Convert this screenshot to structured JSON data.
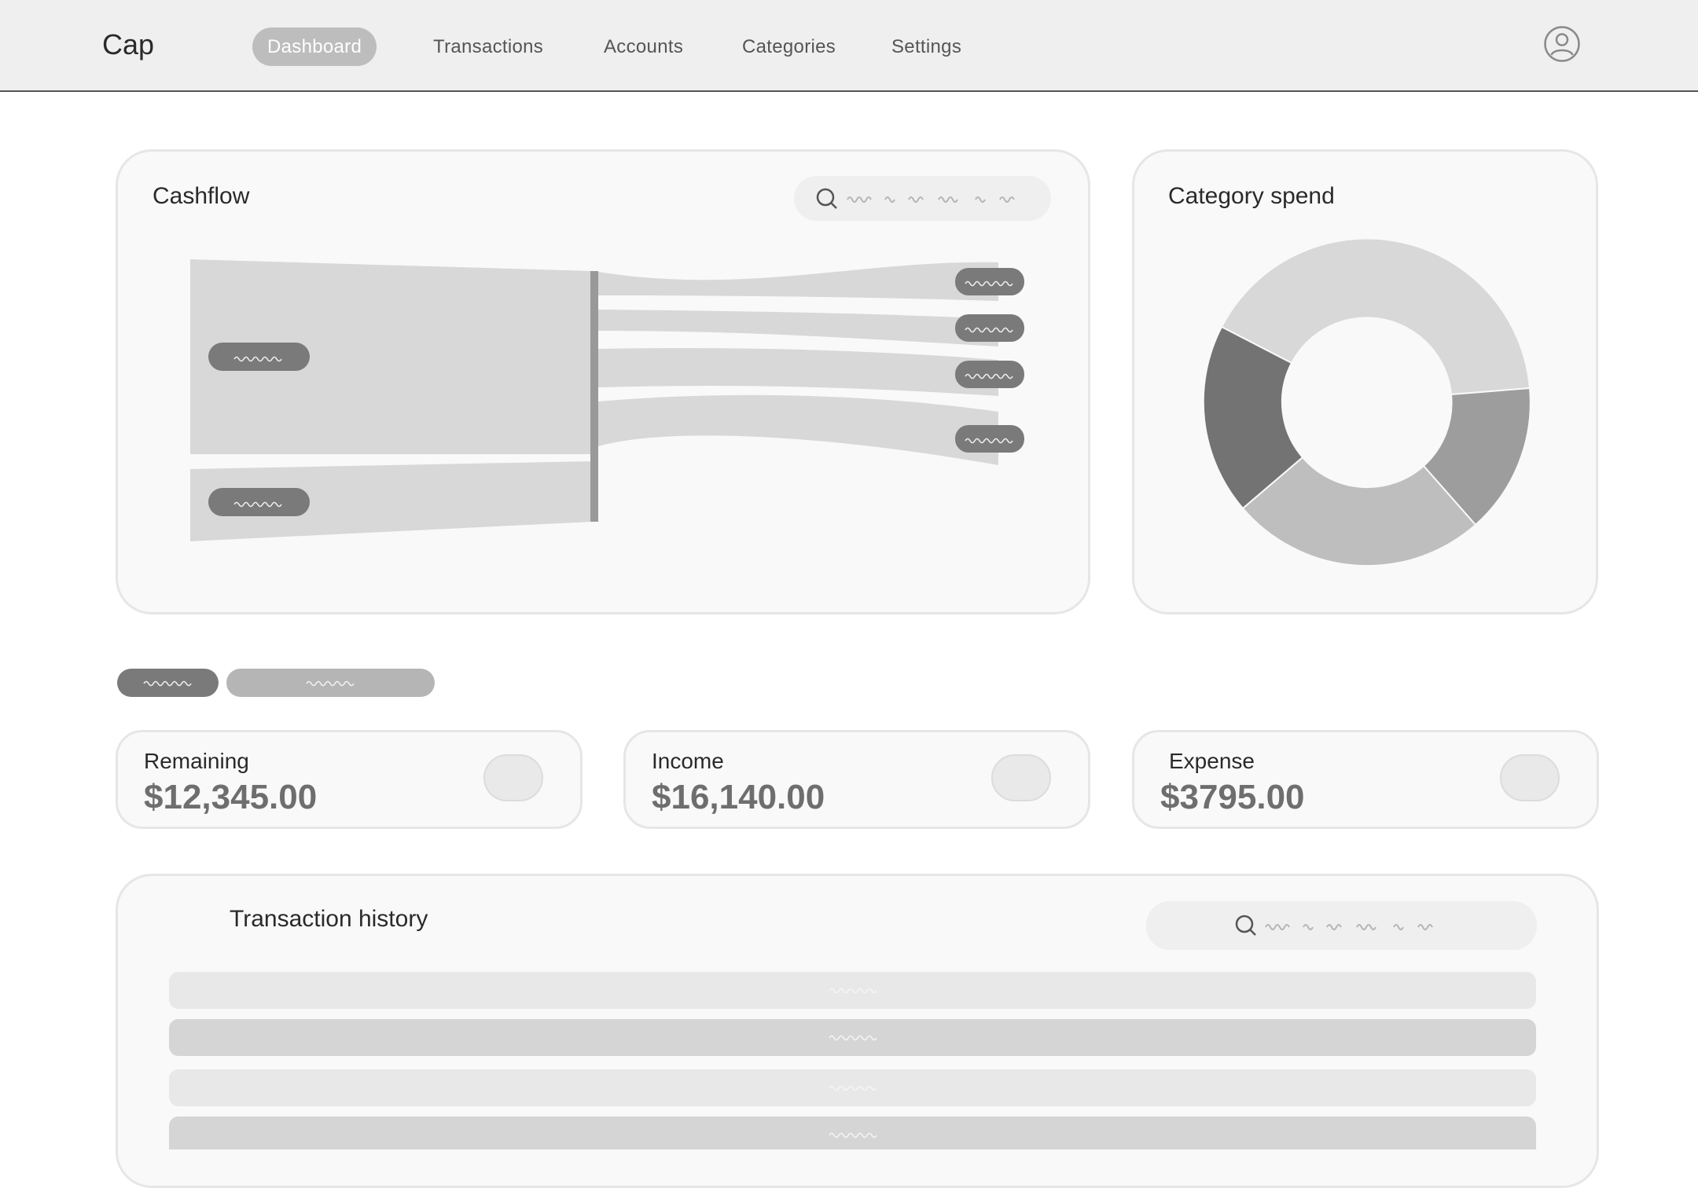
{
  "header": {
    "brand": "Cap",
    "nav": [
      {
        "label": "Dashboard",
        "active": true
      },
      {
        "label": "Transactions",
        "active": false
      },
      {
        "label": "Accounts",
        "active": false
      },
      {
        "label": "Categories",
        "active": false
      },
      {
        "label": "Settings",
        "active": false
      }
    ],
    "avatar_icon": "user-circle-icon"
  },
  "cashflow": {
    "title": "Cashflow",
    "search_icon": "search-icon",
    "sources": 2,
    "destinations": 4
  },
  "category_spend": {
    "title": "Category spend",
    "chart_type": "donut",
    "segments": 4
  },
  "period_tabs": {
    "count": 2
  },
  "stats": {
    "remaining": {
      "label": "Remaining",
      "value": "$12,345.00"
    },
    "income": {
      "label": "Income",
      "value": "$16,140.00"
    },
    "expense": {
      "label": "Expense",
      "value": "$3795.00"
    }
  },
  "transactions": {
    "title": "Transaction history",
    "search_icon": "search-icon",
    "rows": 4
  },
  "colors": {
    "topbar_bg": "#efefef",
    "card_bg": "#f9f9f9",
    "active_nav": "#bdbdbd",
    "pill_dark": "#7a7a7a",
    "pill_mid": "#b5b5b5",
    "flow": "#d8d8d8",
    "stat_value": "#6e6e6e"
  }
}
